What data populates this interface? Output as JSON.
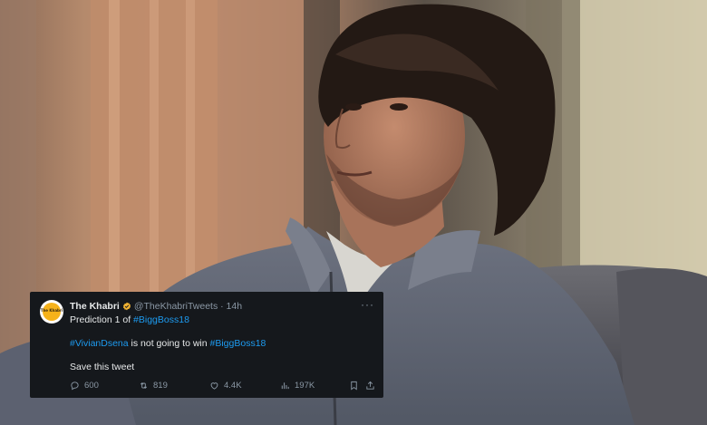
{
  "tweet": {
    "name": "The Khabri",
    "handle": "@TheKhabriTweets · 14h",
    "avatar_logo_text": "The Khabri",
    "line1_prefix": "Prediction 1 of ",
    "line1_tag": "#BiggBoss18",
    "line2_tag1": "#VivianDsena",
    "line2_middle": " is not going to win ",
    "line2_tag2": "#BiggBoss18",
    "line3": "Save this tweet",
    "more_label": "···",
    "stats": {
      "replies": "600",
      "retweets": "819",
      "likes": "4.4K",
      "views": "197K"
    }
  },
  "icons": {
    "verified": "verified-badge-icon",
    "reply": "reply-icon",
    "retweet": "retweet-icon",
    "like": "heart-icon",
    "views": "views-chart-icon",
    "bookmark": "bookmark-icon",
    "share": "share-icon"
  },
  "colors": {
    "card_bg": "#15181c",
    "hashtag": "#1d9bf0",
    "muted": "#8b98a5",
    "verified": "#f0b232"
  }
}
